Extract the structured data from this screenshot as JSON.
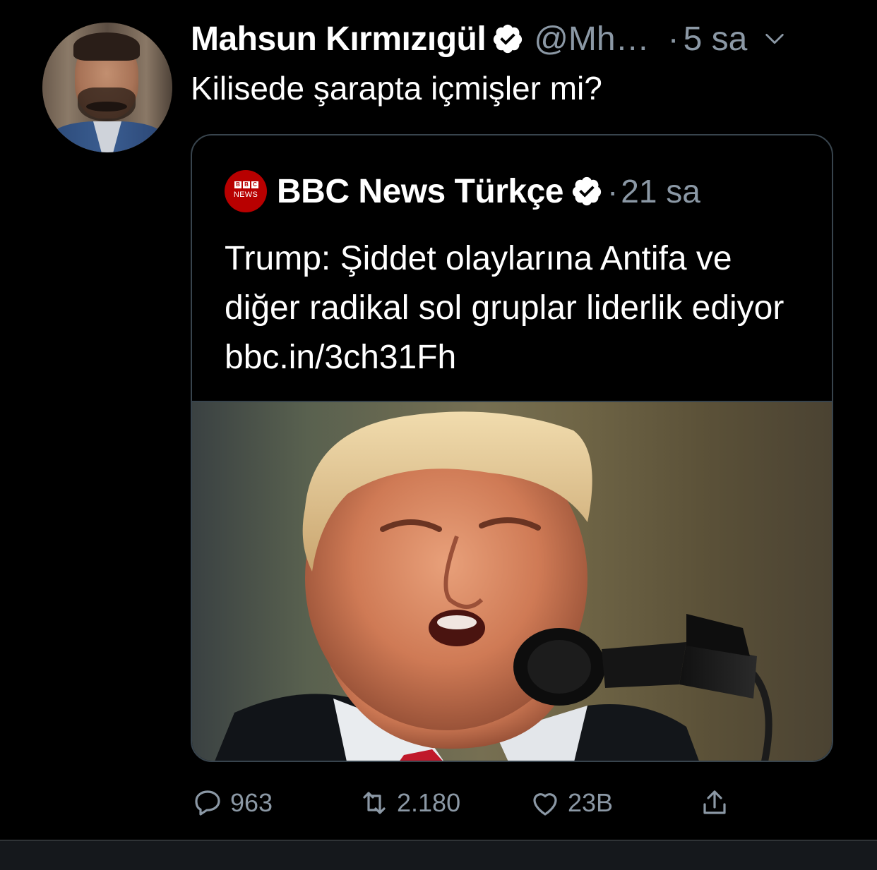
{
  "tweet": {
    "author": {
      "display_name": "Mahsun Kırmızıgül",
      "handle": "@Mh…",
      "verified": true
    },
    "separator": "·",
    "time": "5 sa",
    "text": "Kilisede şarapta içmişler mi?",
    "quoted": {
      "logo_boxes": [
        "B",
        "B",
        "C"
      ],
      "logo_text": "NEWS",
      "display_name": "BBC News Türkçe",
      "verified": true,
      "separator": "·",
      "time": "21 sa",
      "text": "Trump: Şiddet olaylarına Antifa ve diğer radikal sol gruplar liderlik ediyor bbc.in/3ch31Fh"
    },
    "actions": {
      "reply_count": "963",
      "retweet_count": "2.180",
      "like_count": "23B"
    }
  },
  "colors": {
    "background": "#000000",
    "text_primary": "#ffffff",
    "text_secondary": "#8b98a5",
    "border": "#38444d",
    "bbc_red": "#b80000"
  },
  "icons": {
    "verified": "verified-badge-icon",
    "menu": "chevron-down-icon",
    "reply": "speech-bubble-icon",
    "retweet": "retweet-arrows-icon",
    "like": "heart-icon",
    "share": "share-upload-icon"
  }
}
